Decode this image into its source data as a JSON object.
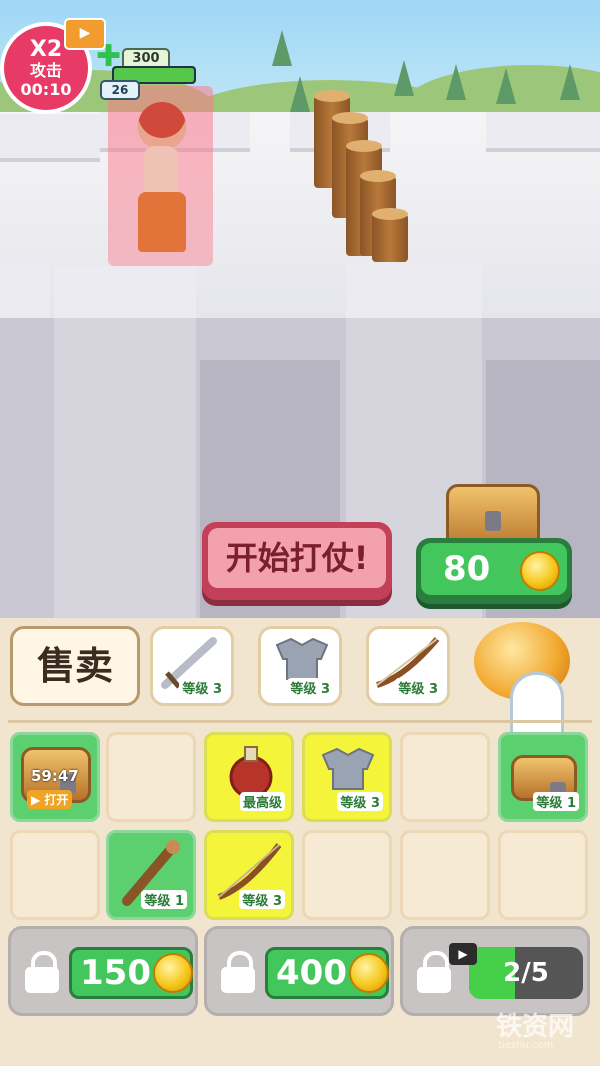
{
  "hud": {
    "multiplier": "X2",
    "buff_label": "攻击",
    "buff_timer": "00:10",
    "hp_value": "300",
    "hp_fraction": 1.0,
    "attack_value": "26",
    "icons": [
      "video-icon",
      "plus-icon"
    ]
  },
  "actions": {
    "start_battle": "开始打仗!",
    "coins": "80"
  },
  "equipment": {
    "sell_label": "售卖",
    "slots": [
      {
        "icon": "sword-icon",
        "level": "等级 3"
      },
      {
        "icon": "armor-icon",
        "level": "等级 3"
      },
      {
        "icon": "bow-icon",
        "level": "等级 3"
      }
    ],
    "piggy_icon": "piggy-bank-icon"
  },
  "grid": {
    "row1": [
      {
        "type": "chest",
        "timer": "59:47",
        "action": "打开",
        "color": "green"
      },
      {
        "type": "empty"
      },
      {
        "type": "potion",
        "level": "最高级",
        "color": "yellow"
      },
      {
        "type": "armor",
        "level": "等级 3",
        "color": "yellow"
      },
      {
        "type": "empty"
      },
      {
        "type": "chest",
        "level": "等级 1",
        "color": "green"
      }
    ],
    "row2": [
      {
        "type": "empty"
      },
      {
        "type": "club",
        "level": "等级 1",
        "color": "green"
      },
      {
        "type": "bow",
        "level": "等级 3",
        "color": "yellow"
      },
      {
        "type": "empty"
      },
      {
        "type": "empty"
      },
      {
        "type": "empty"
      }
    ]
  },
  "slots": [
    {
      "price": "150",
      "locked": true
    },
    {
      "price": "400",
      "locked": true
    },
    {
      "progress": "2/5",
      "progress_fraction": 0.4,
      "locked": true
    }
  ],
  "watermark": {
    "text": "铁资网",
    "sub": "tiezhu.com"
  },
  "colors": {
    "accent_green": "#43c75d",
    "accent_pink": "#e83a66",
    "button_red": "#c24159"
  }
}
